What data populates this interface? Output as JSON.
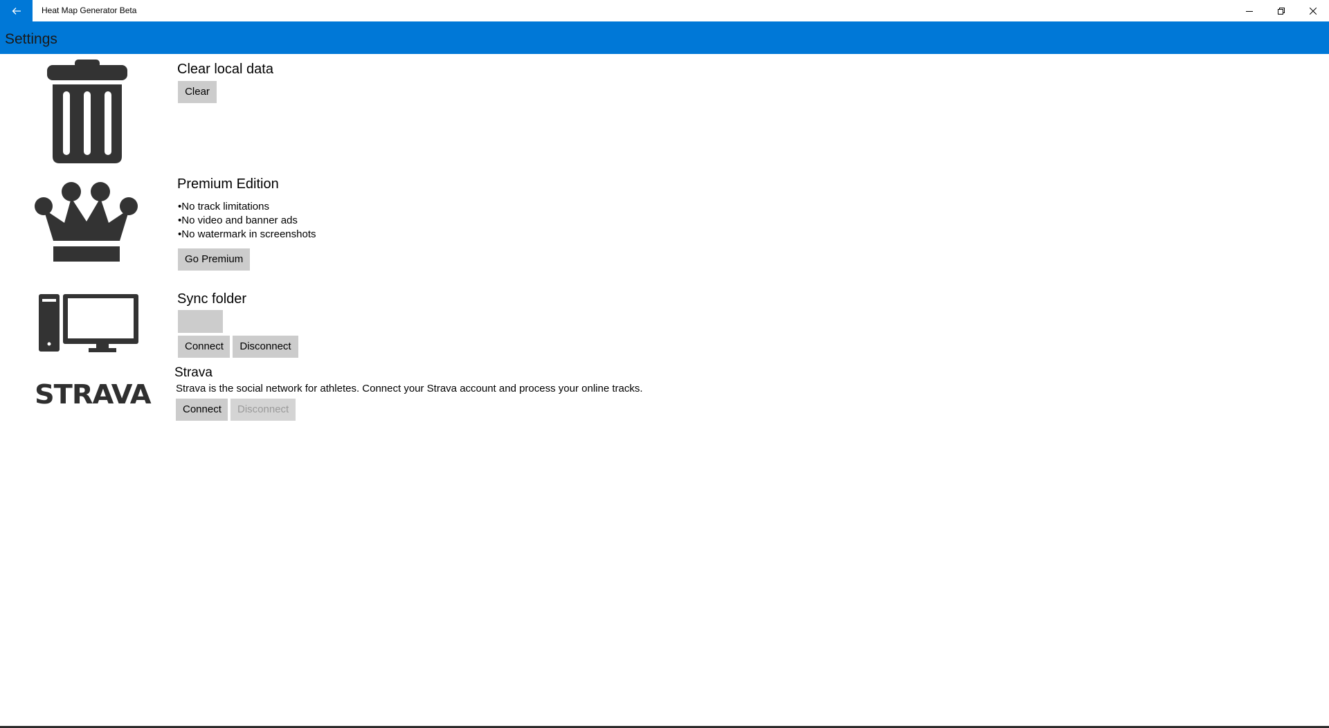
{
  "window": {
    "title": "Heat Map Generator Beta",
    "accent_color": "#0078d7"
  },
  "header": {
    "title": "Settings"
  },
  "icons": {
    "back": "back-arrow-icon",
    "minimize": "minimize-icon",
    "maximize": "restore-icon",
    "close": "close-icon",
    "clear_section": "trash-can-icon",
    "premium_section": "crown-icon",
    "sync_section": "desktop-computer-icon",
    "strava_section": "strava-logo"
  },
  "clear_data": {
    "title": "Clear local data",
    "clear_label": "Clear"
  },
  "premium": {
    "title": "Premium Edition",
    "features": [
      "No track limitations",
      "No video and banner ads",
      "No watermark in screenshots"
    ],
    "button_label": "Go Premium"
  },
  "sync_folder": {
    "title": "Sync folder",
    "folder_value": "",
    "connect_label": "Connect",
    "disconnect_label": "Disconnect"
  },
  "strava": {
    "logo_text": "STRAVA",
    "title": "Strava",
    "description": "Strava is the social network for athletes. Connect your Strava account and process your online tracks.",
    "connect_label": "Connect",
    "disconnect_label": "Disconnect",
    "disconnect_enabled": false
  }
}
